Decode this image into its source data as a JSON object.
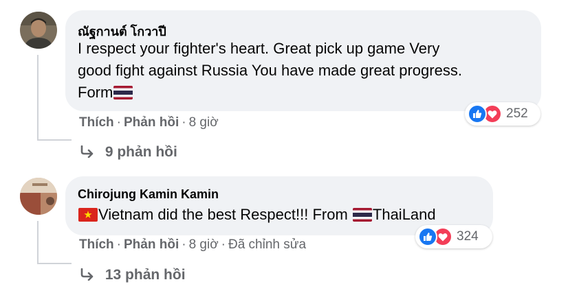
{
  "comments": [
    {
      "author": "ณัฐกานต์ โกวาปี",
      "text_line1": "I respect your fighter's heart. Great pick up game Very",
      "text_line2": "good fight against Russia You have made great progress.",
      "text_line3": "Form",
      "like_label": "Thích",
      "reply_label": "Phản hồi",
      "time": "8 giờ",
      "reaction_count": "252",
      "replies_label": "9 phản hồi"
    },
    {
      "author": "Chirojung Kamin Kamin",
      "text_part1": "Vietnam did the best Respect!!! From ",
      "text_part2": "ThaiLand",
      "like_label": "Thích",
      "reply_label": "Phản hồi",
      "time": "8 giờ",
      "edited_label": "Đã chỉnh sửa",
      "reaction_count": "324",
      "replies_label": "13 phản hồi"
    }
  ],
  "icons": {
    "like": "like-icon",
    "love": "love-icon",
    "reply_arrow": "reply-arrow-icon",
    "flag_thailand": "thailand-flag-icon",
    "flag_vietnam": "vietnam-flag-icon"
  },
  "colors": {
    "like_blue": "#1877f2",
    "love_red": "#f33e58",
    "bubble_bg": "#f0f2f5",
    "meta_gray": "#65676b"
  }
}
